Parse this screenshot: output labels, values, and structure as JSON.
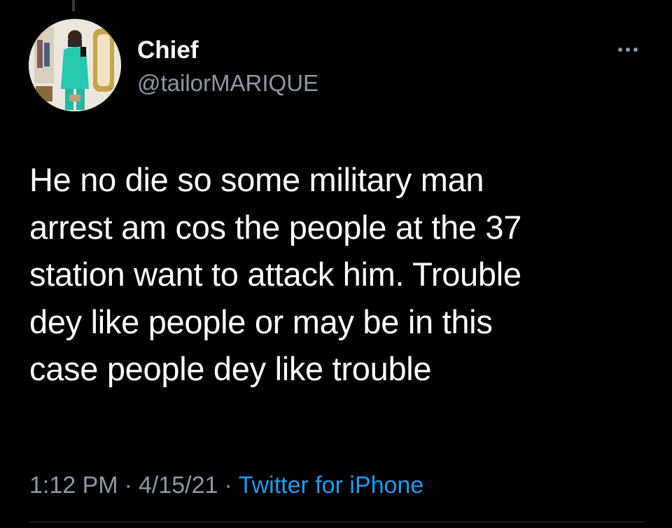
{
  "author": {
    "display_name": "Chief",
    "handle": "@tailorMARIQUE",
    "avatar_icon": "profile-photo"
  },
  "tweet": {
    "text": "He no die so some military man\narrest am cos the people at the 37\nstation want to attack him. Trouble\ndey like people or may be in this\ncase people dey like trouble"
  },
  "meta": {
    "time": "1:12 PM",
    "date": "4/15/21",
    "separator": "·",
    "source": "Twitter for iPhone"
  },
  "colors": {
    "background": "#000000",
    "primary_text": "#ffffff",
    "secondary_text": "#8b98a5",
    "link": "#1d9bf0"
  }
}
